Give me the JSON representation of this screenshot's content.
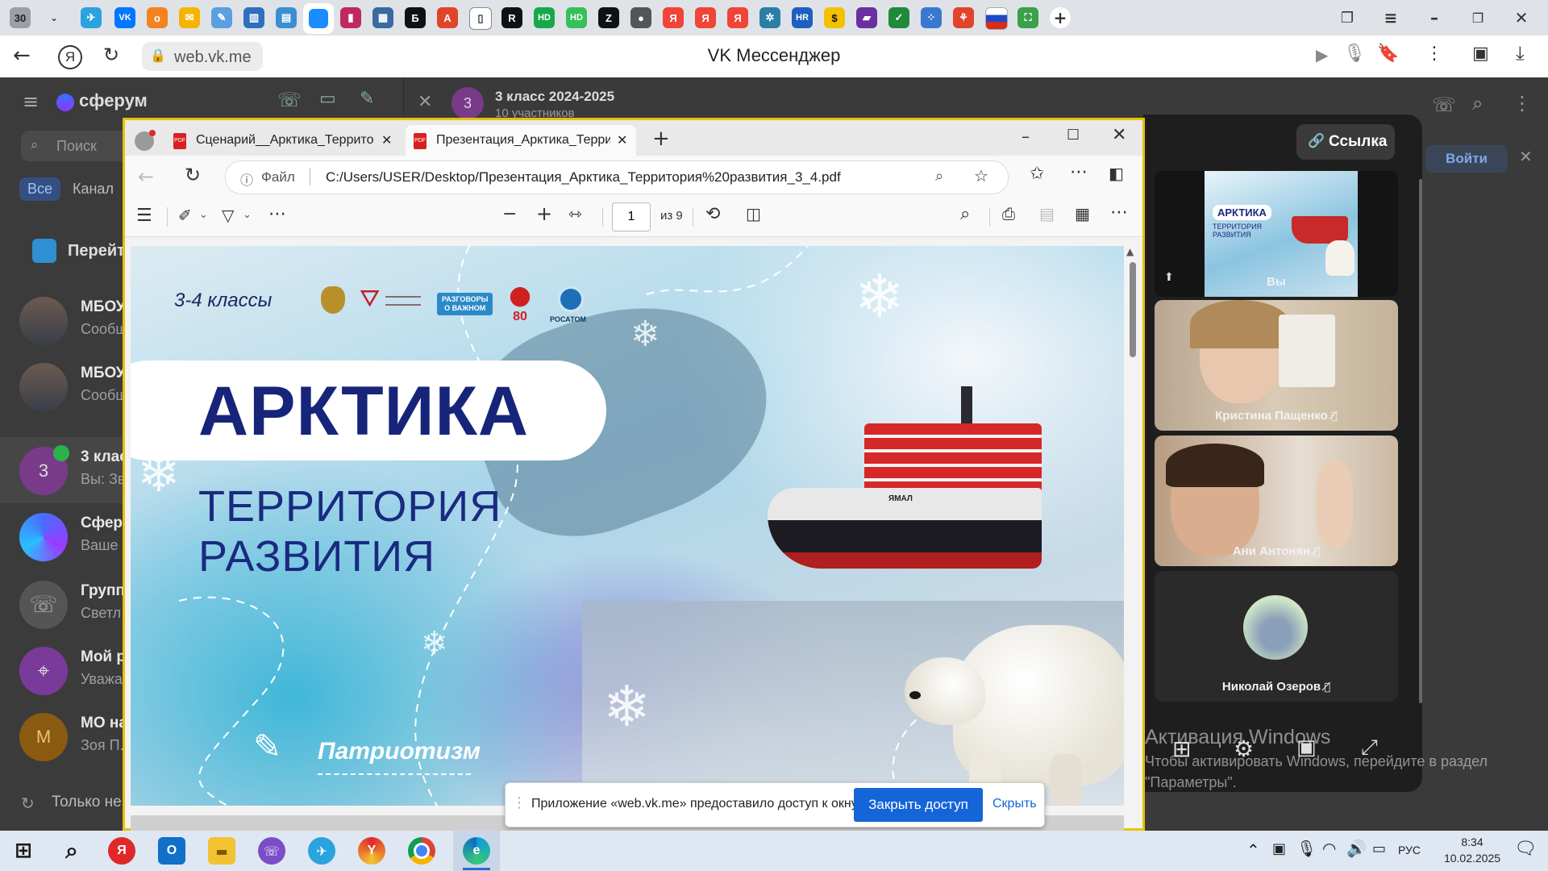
{
  "browser": {
    "tab_count": "30",
    "url": "web.vk.me",
    "title": "VK Мессенджер"
  },
  "vk": {
    "brand": "сферум",
    "search_placeholder": "Поиск",
    "filters": [
      "Все",
      "Канал"
    ],
    "goto_label": "Перейт",
    "chat_header": {
      "title": "3 класс 2024-2025",
      "subtitle": "10 участников",
      "avatar": "3"
    },
    "login": "Войти",
    "bottom_hint": "Только не",
    "chats": [
      {
        "name": "МБОУ",
        "sub": "Сообщ",
        "avatar": ""
      },
      {
        "name": "МБОУ",
        "sub": "Сообщ",
        "avatar": ""
      },
      {
        "name": "3 клас",
        "sub": "Вы: Зв",
        "avatar": "3"
      },
      {
        "name": "Сферу",
        "sub": "Ваше",
        "avatar": ""
      },
      {
        "name": "Групп",
        "sub": "Светл",
        "avatar": ""
      },
      {
        "name": "Мой р",
        "sub": "Уважа",
        "avatar": ""
      },
      {
        "name": "МО на",
        "sub": "Зоя П.",
        "avatar": "М"
      }
    ]
  },
  "pdf": {
    "tabs": [
      {
        "label": "Сценарий__Арктика_Территори"
      },
      {
        "label": "Презентация_Арктика_Террито"
      }
    ],
    "file_label": "Файл",
    "path": "C:/Users/USER/Desktop/Презентация_Арктика_Территория%20развития_3_4.pdf",
    "page_current": "1",
    "page_total": "из 9",
    "slide": {
      "grade": "3-4 классы",
      "title": "АРКТИКА",
      "subtitle1": "ТЕРРИТОРИЯ",
      "subtitle2": "РАЗВИТИЯ",
      "topic": "Патриотизм",
      "logo_razgovory_1": "РАЗГОВОРЫ",
      "logo_razgovory_2": "О ВАЖНОМ",
      "logo_80": "80",
      "logo_rosatom": "РОСАТОМ",
      "ship_name": "ЯМАЛ"
    }
  },
  "call": {
    "link_button": "Ссылка",
    "participants": [
      {
        "name": "Вы"
      },
      {
        "name": "Кристина Пащенко"
      },
      {
        "name": "Ани Антонян"
      },
      {
        "name": "Николай Озеров"
      }
    ],
    "self_preview": {
      "title": "АРКТИКА",
      "sub": "ТЕРРИТОРИЯ РАЗВИТИЯ"
    }
  },
  "share_bar": {
    "message": "Приложение «web.vk.me» предоставило доступ к окну.",
    "stop_button": "Закрыть доступ",
    "hide_link": "Скрыть"
  },
  "watermark": {
    "line1": "Активация Windows",
    "line2": "Чтобы активировать Windows, перейдите в раздел",
    "line3": "\"Параметры\"."
  },
  "taskbar": {
    "lang": "РУС",
    "time": "8:34",
    "date": "10.02.2025"
  },
  "colors": {
    "vk_blue": "#0077ff",
    "share_btn": "#1565d8",
    "navy_title": "#1a2a80",
    "window_border": "#e7c300"
  }
}
